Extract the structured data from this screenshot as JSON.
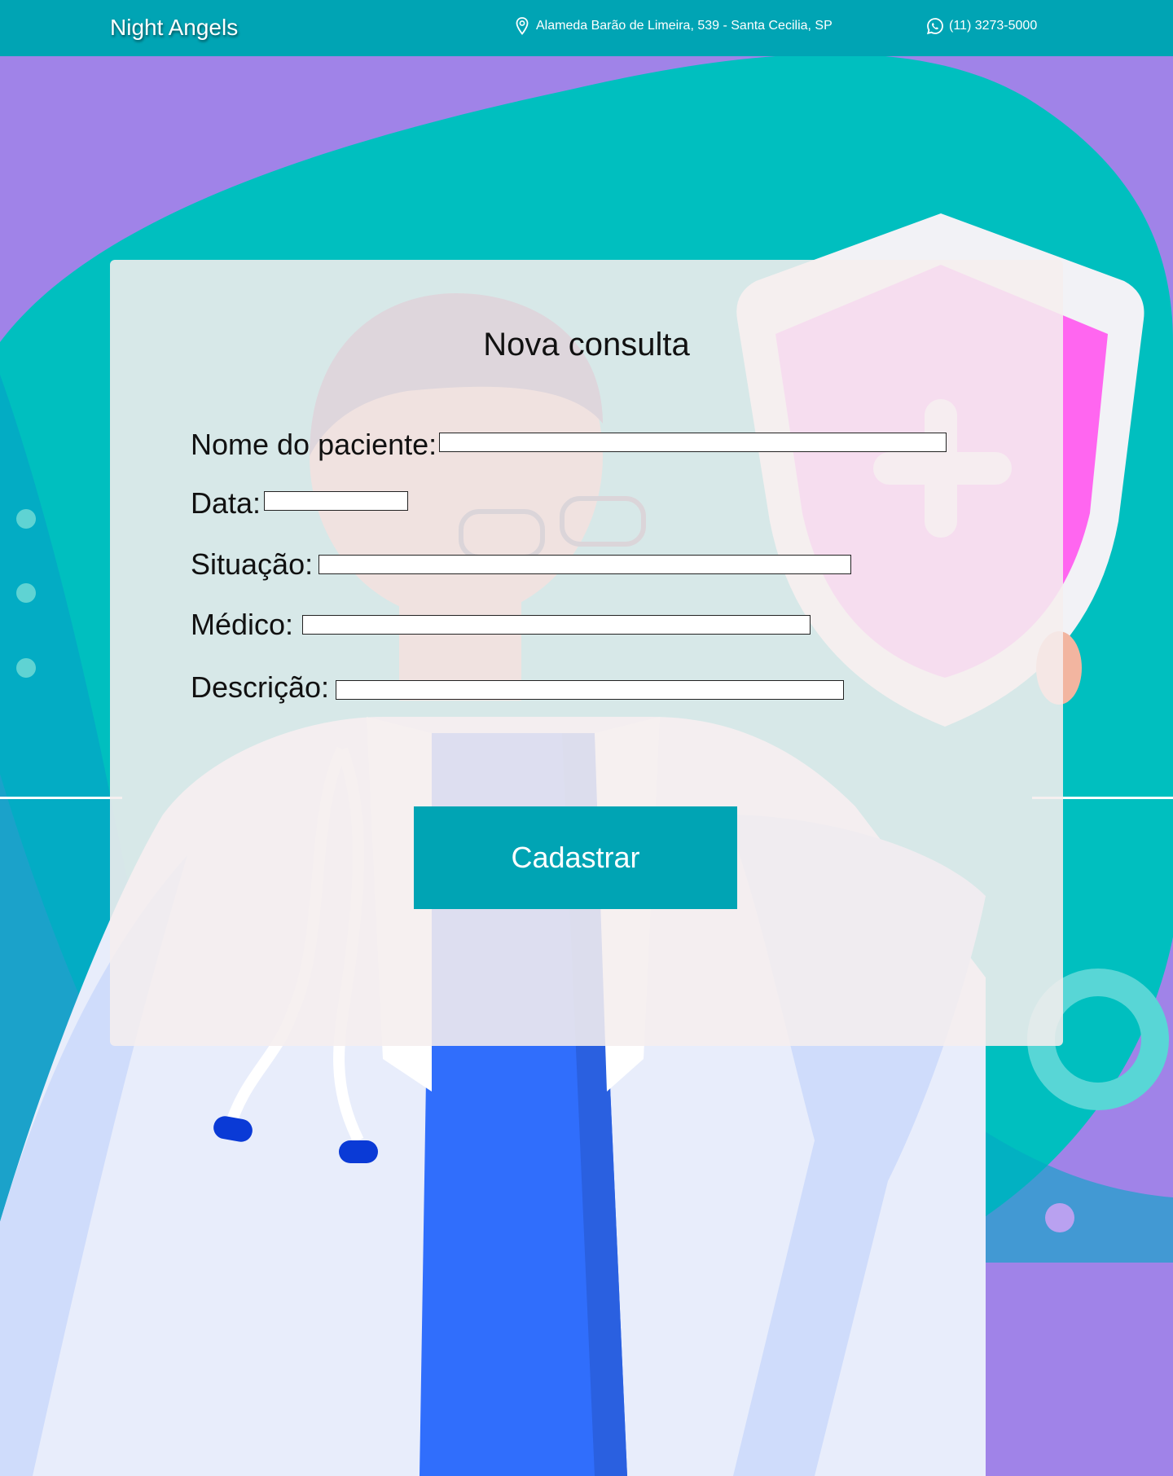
{
  "header": {
    "brand": "Night Angels",
    "address": "Alameda Barão de Limeira, 539 - Santa Cecilia, SP",
    "address_icon": "map-pin-icon",
    "phone": "(11) 3273-5000",
    "phone_icon": "whatsapp-icon"
  },
  "form": {
    "title": "Nova consulta",
    "fields": [
      {
        "label": "Nome do paciente:",
        "value": ""
      },
      {
        "label": "Data:",
        "value": ""
      },
      {
        "label": "Situação:",
        "value": ""
      },
      {
        "label": "Médico:",
        "value": ""
      },
      {
        "label": "Descrição:",
        "value": ""
      }
    ],
    "submit_label": "Cadastrar"
  },
  "colors": {
    "topbar": "#00a4b4",
    "background": "#a083e8",
    "blob": "#00bfbf",
    "button": "#00a4b4",
    "card": "#f5eeee"
  }
}
